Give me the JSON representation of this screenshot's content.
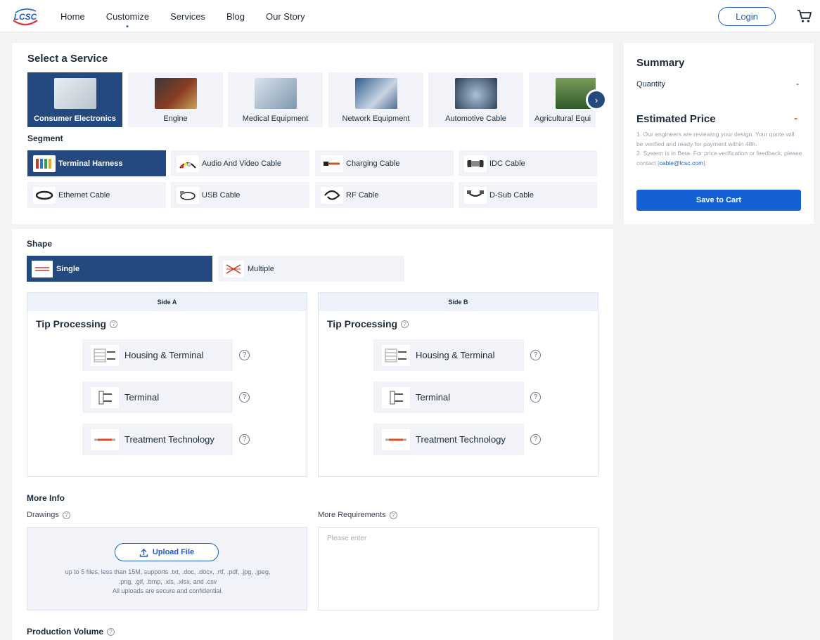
{
  "header": {
    "logo_text": "LCSC",
    "nav": [
      "Home",
      "Customize",
      "Services",
      "Blog",
      "Our Story"
    ],
    "login_label": "Login"
  },
  "service": {
    "title": "Select a Service",
    "items": [
      {
        "label": "Consumer Electronics",
        "active": true
      },
      {
        "label": "Engine",
        "active": false
      },
      {
        "label": "Medical Equipment",
        "active": false
      },
      {
        "label": "Network Equipment",
        "active": false
      },
      {
        "label": "Automotive Cable",
        "active": false
      },
      {
        "label": "Agricultural Equi",
        "active": false
      }
    ]
  },
  "segment": {
    "title": "Segment",
    "items": [
      {
        "label": "Terminal Harness",
        "active": true
      },
      {
        "label": "Audio And Video Cable",
        "active": false
      },
      {
        "label": "Charging Cable",
        "active": false
      },
      {
        "label": "IDC Cable",
        "active": false
      },
      {
        "label": "Ethernet Cable",
        "active": false
      },
      {
        "label": "USB Cable",
        "active": false
      },
      {
        "label": "RF Cable",
        "active": false
      },
      {
        "label": "D-Sub Cable",
        "active": false
      }
    ]
  },
  "shape": {
    "title": "Shape",
    "items": [
      {
        "label": "Single",
        "active": true
      },
      {
        "label": "Multiple",
        "active": false
      }
    ]
  },
  "side_a": {
    "header": "Side A",
    "title": "Tip Processing",
    "options": [
      "Housing & Terminal",
      "Terminal",
      "Treatment Technology"
    ]
  },
  "side_b": {
    "header": "Side B",
    "title": "Tip Processing",
    "options": [
      "Housing & Terminal",
      "Terminal",
      "Treatment Technology"
    ]
  },
  "more_info": {
    "title": "More Info",
    "drawings_label": "Drawings",
    "upload_label": "Upload File",
    "upload_note_1": "up to 5 files, less than 15M, supports .txt, .doc, .docx, .rtf, .pdf, .jpg, .jpeg,",
    "upload_note_2": ".png, .gif, .bmp, .xls, .xlsx, and .csv",
    "upload_note_3": "All uploads are secure and confidential.",
    "requirements_label": "More Requirements",
    "requirements_placeholder": "Please enter"
  },
  "production": {
    "title": "Production Volume"
  },
  "summary": {
    "title": "Summary",
    "quantity_label": "Quantity",
    "quantity_value": "-",
    "estimated_title": "Estimated Price",
    "estimated_value": "-",
    "note_1": "1. Our engineers are reviewing your design. Your quote will be verified and ready for payment within 48h.",
    "note_2_prefix": "2. System is in Beta. For price verification or feedback, please contact [",
    "note_2_email": "cable@lcsc.com",
    "note_2_suffix": "].",
    "save_label": "Save to Cart"
  },
  "colors": {
    "primary_dark": "#23497f",
    "accent_blue": "#1560d5",
    "price_orange": "#f06a2b"
  }
}
